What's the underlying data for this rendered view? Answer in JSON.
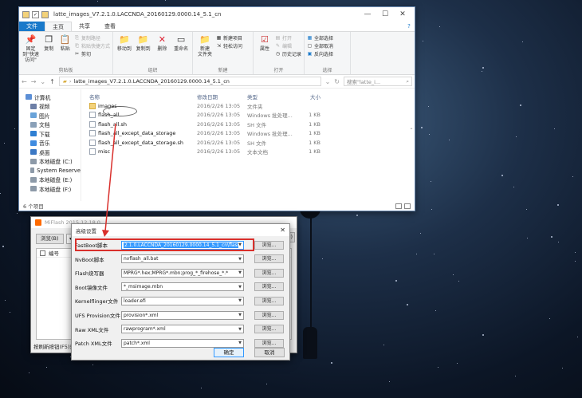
{
  "explorer": {
    "title": "latte_images_V7.2.1.0.LACCNDA_20160129.0000.14_5.1_cn",
    "tabs": {
      "file": "文件",
      "home": "主页",
      "share": "共享",
      "view": "查看"
    },
    "ribbon": {
      "clipboard": {
        "pin": "固定到\"快速访问\"",
        "copy": "复制",
        "paste": "粘贴",
        "copy_path": "复制路径",
        "paste_shortcut": "粘贴快捷方式",
        "cut": "剪切",
        "label": "剪贴板"
      },
      "organize": {
        "move_to": "移动到",
        "copy_to": "复制到",
        "delete": "删除",
        "rename": "重命名",
        "label": "组织"
      },
      "new": {
        "new_item": "新建项目",
        "easy_access": "轻松访问",
        "new_folder": "新建\n文件夹",
        "label": "新建"
      },
      "open": {
        "properties": "属性",
        "open": "打开",
        "edit": "编辑",
        "history": "历史记录",
        "label": "打开"
      },
      "select": {
        "select_all": "全部选择",
        "select_none": "全部取消",
        "invert": "反向选择",
        "label": "选择"
      }
    },
    "address": {
      "path": "latte_images_V7.2.1.0.LACCNDA_20160129.0000.14_5.1_cn",
      "search_placeholder": "搜索\"latte_i...",
      "search_icon": "search-icon"
    },
    "nav": [
      {
        "label": "计算机",
        "color": "#5c8fd6",
        "level": 1
      },
      {
        "label": "视频",
        "color": "#6d7fa6",
        "level": 2
      },
      {
        "label": "图片",
        "color": "#6aa3d9",
        "level": 2
      },
      {
        "label": "文档",
        "color": "#8aa0b8",
        "level": 2
      },
      {
        "label": "下载",
        "color": "#2f7fd2",
        "level": 2
      },
      {
        "label": "音乐",
        "color": "#3f8be0",
        "level": 2
      },
      {
        "label": "桌面",
        "color": "#3b78c4",
        "level": 2
      },
      {
        "label": "本地磁盘 (C:)",
        "color": "#8d9aa8",
        "level": 2
      },
      {
        "label": "System Reserve",
        "color": "#8d9aa8",
        "level": 2
      },
      {
        "label": "本地磁盘 (E:)",
        "color": "#8d9aa8",
        "level": 2
      },
      {
        "label": "本地磁盘 (F:)",
        "color": "#8d9aa8",
        "level": 2
      }
    ],
    "columns": {
      "name": "名称",
      "date": "修改日期",
      "type": "类型",
      "size": "大小"
    },
    "files": [
      {
        "name": "images",
        "date": "2016/2/26 13:05",
        "type": "文件夹",
        "size": "",
        "kind": "folder"
      },
      {
        "name": "flash_all",
        "date": "2016/2/26 13:05",
        "type": "Windows 批处理...",
        "size": "1 KB",
        "kind": "file"
      },
      {
        "name": "flash_all.sh",
        "date": "2016/2/26 13:05",
        "type": "SH 文件",
        "size": "1 KB",
        "kind": "file"
      },
      {
        "name": "flash_all_except_data_storage",
        "date": "2016/2/26 13:05",
        "type": "Windows 批处理...",
        "size": "1 KB",
        "kind": "file"
      },
      {
        "name": "flash_all_except_data_storage.sh",
        "date": "2016/2/26 13:05",
        "type": "SH 文件",
        "size": "1 KB",
        "kind": "file"
      },
      {
        "name": "misc",
        "date": "2016/2/26 13:05",
        "type": "文本文档",
        "size": "1 KB",
        "kind": "file"
      }
    ],
    "status": "6 个项目"
  },
  "miflash": {
    "title": "MiFlash 2015.12.18.0",
    "browse": "浏览(B)",
    "right_btn": "H)",
    "column_no": "编号",
    "status": "按刷新按钮(F5)获"
  },
  "dialog": {
    "title": "高级设置",
    "fields": [
      {
        "label": "FastBoot脚本",
        "value": "2.1.0.LACCNDA_20160129.0000.14_5.1_cn\\flash_all.bat"
      },
      {
        "label": "NvBoot脚本",
        "value": "nvflash_all.bat"
      },
      {
        "label": "Flash烧写器",
        "value": "MPRG*.hex;MPRG*.mbn;prog_*_firehose_*.*"
      },
      {
        "label": "Boot镜像文件",
        "value": "*_msimage.mbn"
      },
      {
        "label": "Kernelflinger文件",
        "value": "loader.efi"
      },
      {
        "label": "UFS Provision文件",
        "value": "provision*.xml"
      },
      {
        "label": "Raw XML文件",
        "value": "rawprogram*.xml"
      },
      {
        "label": "Patch XML文件",
        "value": "patch*.xml"
      }
    ],
    "browse_label": "浏览...",
    "ok": "确定",
    "cancel": "取消"
  },
  "colors": {
    "annotation": "#d9302c",
    "accent": "#1979ca"
  }
}
